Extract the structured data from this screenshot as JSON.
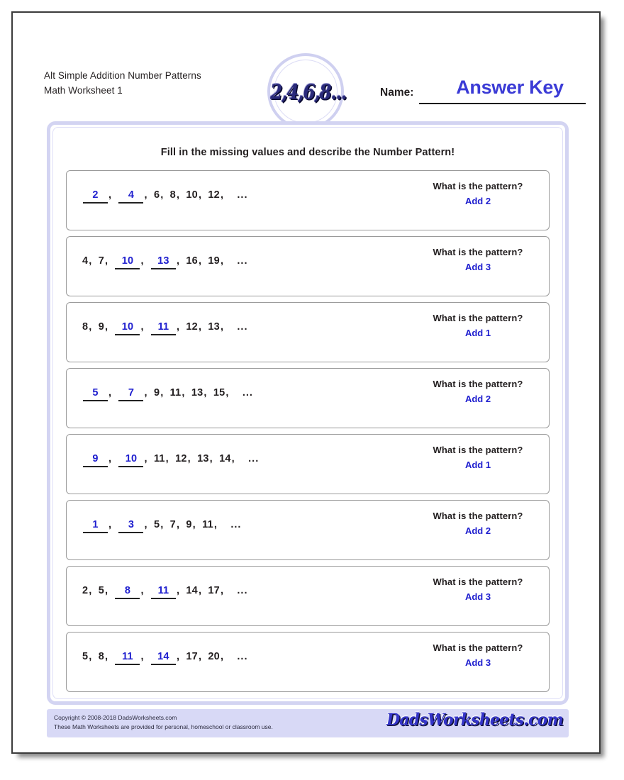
{
  "header": {
    "worksheet_title": "Alt Simple Addition Number Patterns",
    "worksheet_subtitle": "Math Worksheet 1",
    "logo_text": "2,4,6,8...",
    "name_label": "Name:",
    "answer_key_text": "Answer Key"
  },
  "instructions": "Fill in the missing values and describe the Number Pattern!",
  "question_label": "What is the pattern?",
  "problems": [
    {
      "tokens": [
        {
          "t": "blank",
          "v": "2"
        },
        {
          "t": "num",
          "v": "4"
        },
        {
          "t": "num",
          "v": "6"
        },
        {
          "t": "num",
          "v": "8"
        },
        {
          "t": "num",
          "v": "10"
        },
        {
          "t": "num",
          "v": "12"
        }
      ],
      "sequence": "2, 4, 6, 8, 10, 12, ...",
      "blanks": [
        "2",
        "4"
      ],
      "question": "What is the pattern?",
      "answer": "Add 2"
    },
    {
      "tokens": [
        {
          "t": "num",
          "v": "4"
        },
        {
          "t": "num",
          "v": "7"
        },
        {
          "t": "blank",
          "v": "10"
        },
        {
          "t": "blank",
          "v": "13"
        },
        {
          "t": "num",
          "v": "16"
        },
        {
          "t": "num",
          "v": "19"
        }
      ],
      "sequence": "4, 7, 10, 13, 16, 19, ...",
      "blanks": [
        "10",
        "13"
      ],
      "question": "What is the pattern?",
      "answer": "Add 3"
    },
    {
      "tokens": [
        {
          "t": "num",
          "v": "8"
        },
        {
          "t": "num",
          "v": "9"
        },
        {
          "t": "blank",
          "v": "10"
        },
        {
          "t": "blank",
          "v": "11"
        },
        {
          "t": "num",
          "v": "12"
        },
        {
          "t": "num",
          "v": "13"
        }
      ],
      "sequence": "8, 9, 10, 11, 12, 13, ...",
      "blanks": [
        "10",
        "11"
      ],
      "question": "What is the pattern?",
      "answer": "Add 1"
    },
    {
      "tokens": [
        {
          "t": "blank",
          "v": "5"
        },
        {
          "t": "blank",
          "v": "7"
        },
        {
          "t": "num",
          "v": "9"
        },
        {
          "t": "num",
          "v": "11"
        },
        {
          "t": "num",
          "v": "13"
        },
        {
          "t": "num",
          "v": "15"
        }
      ],
      "sequence": "5, 7, 9, 11, 13, 15, ...",
      "blanks": [
        "5",
        "7"
      ],
      "question": "What is the pattern?",
      "answer": "Add 2"
    },
    {
      "tokens": [
        {
          "t": "blank",
          "v": "9"
        },
        {
          "t": "blank",
          "v": "10"
        },
        {
          "t": "num",
          "v": "11"
        },
        {
          "t": "num",
          "v": "12"
        },
        {
          "t": "num",
          "v": "13"
        },
        {
          "t": "num",
          "v": "14"
        }
      ],
      "sequence": "9, 10, 11, 12, 13, 14, ...",
      "blanks": [
        "9",
        "10"
      ],
      "question": "What is the pattern?",
      "answer": "Add 1"
    },
    {
      "tokens": [
        {
          "t": "blank",
          "v": "1"
        },
        {
          "t": "blank",
          "v": "3"
        },
        {
          "t": "num",
          "v": "5"
        },
        {
          "t": "num",
          "v": "7"
        },
        {
          "t": "num",
          "v": "9"
        },
        {
          "t": "num",
          "v": "11"
        }
      ],
      "sequence": "1, 3, 5, 7, 9, 11, ...",
      "blanks": [
        "1",
        "3"
      ],
      "question": "What is the pattern?",
      "answer": "Add 2"
    },
    {
      "tokens": [
        {
          "t": "num",
          "v": "2"
        },
        {
          "t": "num",
          "v": "5"
        },
        {
          "t": "blank",
          "v": "8"
        },
        {
          "t": "blank",
          "v": "11"
        },
        {
          "t": "num",
          "v": "14"
        },
        {
          "t": "num",
          "v": "17"
        }
      ],
      "sequence": "2, 5, 8, 11, 14, 17, ...",
      "blanks": [
        "8",
        "11"
      ],
      "question": "What is the pattern?",
      "answer": "Add 3"
    },
    {
      "tokens": [
        {
          "t": "num",
          "v": "5"
        },
        {
          "t": "num",
          "v": "8"
        },
        {
          "t": "blank",
          "v": "11"
        },
        {
          "t": "blank",
          "v": "14"
        },
        {
          "t": "num",
          "v": "17"
        },
        {
          "t": "num",
          "v": "20"
        }
      ],
      "sequence": "5, 8, 11, 14, 17, 20, ...",
      "blanks": [
        "11",
        "14"
      ],
      "question": "What is the pattern?",
      "answer": "Add 3"
    }
  ],
  "ellipsis": "...",
  "footer": {
    "copyright_line1": "Copyright © 2008-2018 DadsWorksheets.com",
    "copyright_line2": "These Math Worksheets are provided for personal, homeschool or classroom use.",
    "brand": "DadsWorksheets.com"
  },
  "colors": {
    "answer_blue": "#2020cf",
    "panel_lavender": "#d3d4f2",
    "footer_lavender": "#d8d9f6"
  }
}
